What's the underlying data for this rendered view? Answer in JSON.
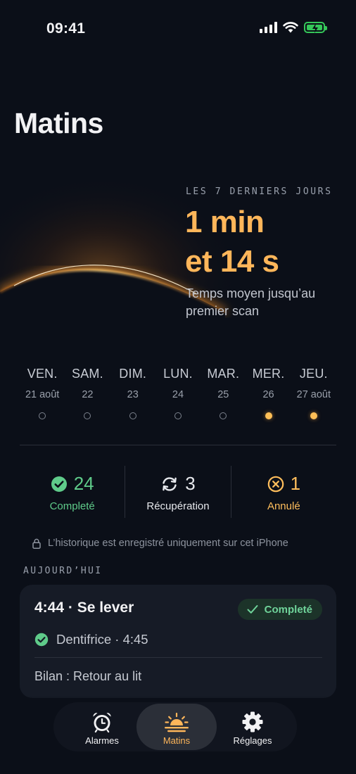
{
  "status_bar": {
    "time": "09:41"
  },
  "page": {
    "title": "Matins"
  },
  "summary": {
    "eyebrow": "LES 7 DERNIERS JOURS",
    "value_line1": "1 min",
    "value_line2": "et 14 s",
    "caption": "Temps moyen jusqu’au premier scan",
    "accent_color": "#ffb65a"
  },
  "week": {
    "days": [
      {
        "name": "VEN.",
        "date": "21 août",
        "done": false
      },
      {
        "name": "SAM.",
        "date": "22",
        "done": false
      },
      {
        "name": "DIM.",
        "date": "23",
        "done": false
      },
      {
        "name": "LUN.",
        "date": "24",
        "done": false
      },
      {
        "name": "MAR.",
        "date": "25",
        "done": false
      },
      {
        "name": "MER.",
        "date": "26",
        "done": true
      },
      {
        "name": "JEU.",
        "date": "27 août",
        "done": true
      }
    ]
  },
  "stats": {
    "completed": {
      "value": "24",
      "label": "Completé",
      "color": "#5fcb8a",
      "icon": "check-circle-icon"
    },
    "recovery": {
      "value": "3",
      "label": "Récupération",
      "color": "#e6e8ec",
      "icon": "sync-arrows-icon"
    },
    "cancelled": {
      "value": "1",
      "label": "Annulé",
      "color": "#ffbe5c",
      "icon": "x-circle-icon"
    }
  },
  "privacy": {
    "text": "L’historique est enregistré uniquement sur cet iPhone",
    "icon": "lock-icon"
  },
  "today": {
    "section_title": "AUJOURD’HUI",
    "card": {
      "title": "4:44 · Se lever",
      "status": "Completé",
      "task": "Dentifrice · 4:45",
      "bilan": "Bilan : Retour au lit"
    }
  },
  "tabs": [
    {
      "label": "Alarmes",
      "icon": "alarm-clock-icon",
      "active": false
    },
    {
      "label": "Matins",
      "icon": "sunrise-icon",
      "active": true
    },
    {
      "label": "Réglages",
      "icon": "gear-icon",
      "active": false
    }
  ]
}
